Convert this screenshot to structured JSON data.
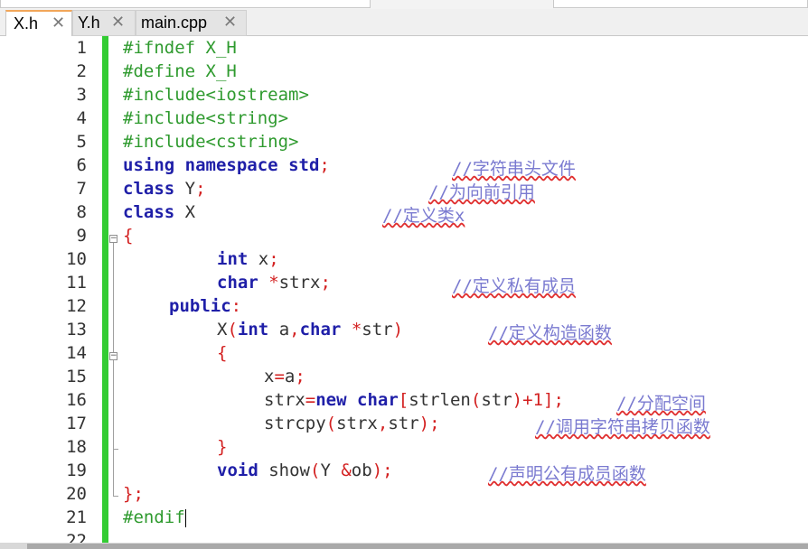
{
  "tabs": [
    {
      "label": "X.h",
      "active": true,
      "close": "✕"
    },
    {
      "label": "Y.h",
      "active": false,
      "close": "✕"
    },
    {
      "label": "main.cpp",
      "active": false,
      "close": "✕"
    }
  ],
  "line_numbers": [
    "1",
    "2",
    "3",
    "4",
    "5",
    "6",
    "7",
    "8",
    "9",
    "10",
    "11",
    "12",
    "13",
    "14",
    "15",
    "16",
    "17",
    "18",
    "19",
    "20",
    "21",
    "22"
  ],
  "code": {
    "l1": "#ifndef X_H",
    "l2": "#define X_H",
    "l3": "#include<iostream>",
    "l4": "#include<string>",
    "l5": "#include<cstring>",
    "l6": {
      "kw1": "using",
      "kw2": "namespace",
      "kw3": "std",
      "semi": ";",
      "comment": "//字符串头文件"
    },
    "l7": {
      "kw": "class",
      "name": "Y",
      "semi": ";",
      "comment": "//为向前引用"
    },
    "l8": {
      "kw": "class",
      "name": "X",
      "comment": "//定义类x"
    },
    "l9": "{",
    "l10": {
      "kw": "int",
      "name": "x",
      "semi": ";"
    },
    "l11": {
      "kw": "char",
      "star": "*",
      "name": "strx",
      "semi": ";",
      "comment": "//定义私有成员"
    },
    "l12": {
      "kw": "public",
      "colon": ":"
    },
    "l13": {
      "name": "X",
      "lp": "(",
      "kw1": "int",
      "a": "a",
      "comma": ",",
      "kw2": "char",
      "star": "*",
      "str": "str",
      "rp": ")",
      "comment": "//定义构造函数"
    },
    "l14": "{",
    "l15": {
      "x": "x",
      "eq": "=",
      "a": "a",
      "semi": ";"
    },
    "l16": {
      "strx": "strx",
      "eq": "=",
      "kw1": "new",
      "kw2": "char",
      "lb": "[",
      "fn": "strlen",
      "lp": "(",
      "arg": "str",
      "rp": ")",
      "plus": "+",
      "one": "1",
      "rb": "]",
      "semi": ";",
      "comment": "//分配空间"
    },
    "l17": {
      "fn": "strcpy",
      "lp": "(",
      "a1": "strx",
      "comma": ",",
      "a2": "str",
      "rp": ")",
      "semi": ";",
      "comment": "//调用字符串拷贝函数"
    },
    "l18": "}",
    "l19": {
      "kw": "void",
      "fn": "show",
      "lp": "(",
      "type": "Y",
      "amp": "&",
      "ob": "ob",
      "rp": ")",
      "semi": ";",
      "comment": "//声明公有成员函数"
    },
    "l20": {
      "brace": "}",
      "semi": ";"
    },
    "l21": "#endif"
  },
  "colors": {
    "keyword": "#1f1fa8",
    "preprocessor": "#2e9a2e",
    "operator": "#d32020",
    "comment": "#7a7ad0",
    "change_bar": "#33cc33",
    "active_tab_accent": "#f2a65a"
  },
  "icons": {
    "fold_open": "⊟",
    "tab_close": "close-icon"
  }
}
